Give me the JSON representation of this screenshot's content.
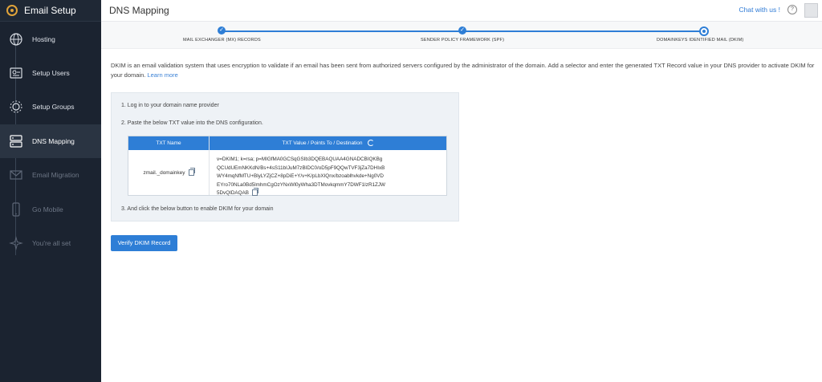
{
  "app": {
    "title": "Email Setup"
  },
  "sidebar": {
    "items": [
      {
        "label": "Hosting",
        "icon": "globe-icon",
        "state": "done"
      },
      {
        "label": "Setup Users",
        "icon": "user-card-icon",
        "state": "done"
      },
      {
        "label": "Setup Groups",
        "icon": "gear-icon",
        "state": "done"
      },
      {
        "label": "DNS Mapping",
        "icon": "server-icon",
        "state": "active"
      },
      {
        "label": "Email Migration",
        "icon": "migration-icon",
        "state": "pending"
      },
      {
        "label": "Go Mobile",
        "icon": "mobile-icon",
        "state": "pending"
      },
      {
        "label": "You're all set",
        "icon": "sparkle-icon",
        "state": "pending"
      }
    ]
  },
  "header": {
    "page_title": "DNS Mapping",
    "chat": "Chat with us !",
    "help": "?"
  },
  "stepper": {
    "steps": [
      {
        "label": "MAIL EXCHANGER (MX) RECORDS",
        "state": "done"
      },
      {
        "label": "SENDER POLICY FRAMEWORK (SPF)",
        "state": "done"
      },
      {
        "label": "DOMAINKEYS IDENTIFIED MAIL (DKIM)",
        "state": "current"
      }
    ]
  },
  "content": {
    "description": "DKIM is an email validation system that uses encryption to validate if an email has been sent from authorized servers configured by the administrator of the domain. Add a selector and enter the generated TXT Record value in your DNS provider to activate DKIM for your domain.",
    "learn_more": "Learn more",
    "step1": "1. Log in to your domain name provider",
    "step2": "2. Paste the below TXT value into the DNS configuration.",
    "step3": "3. And click the below button to enable DKIM for your domain",
    "table": {
      "col_name": "TXT Name",
      "col_value": "TXT Value / Points To / Destination",
      "name": "zmail._domainkey",
      "value": "v=DKIM1; k=rsa; p=MIGfMA0GCSqGSIb3DQEBAQUAA4GNADCBIQKBgQCUdUEmNKKdN/Bs+4sS11bIJuM7zBIDC0/oD5pF9QQwTVF3jZa7DHIxBWY4mqNfMTU+BlyLYZjCZ+8pDiE+Y/v+K/pLbXIQnx/bzoablhvkde+Ng0VDEYro70NLa0Bd5lmhmCgOzYNxWl0yWha3DTMovkqmmY7DWF1IzR1ZJW5DvQIDAQAB"
    },
    "verify_button": "Verify DKIM Record"
  },
  "colors": {
    "sidebar_bg": "#1b2330",
    "accent": "#2e7ed6",
    "card_bg": "#eef2f6"
  }
}
